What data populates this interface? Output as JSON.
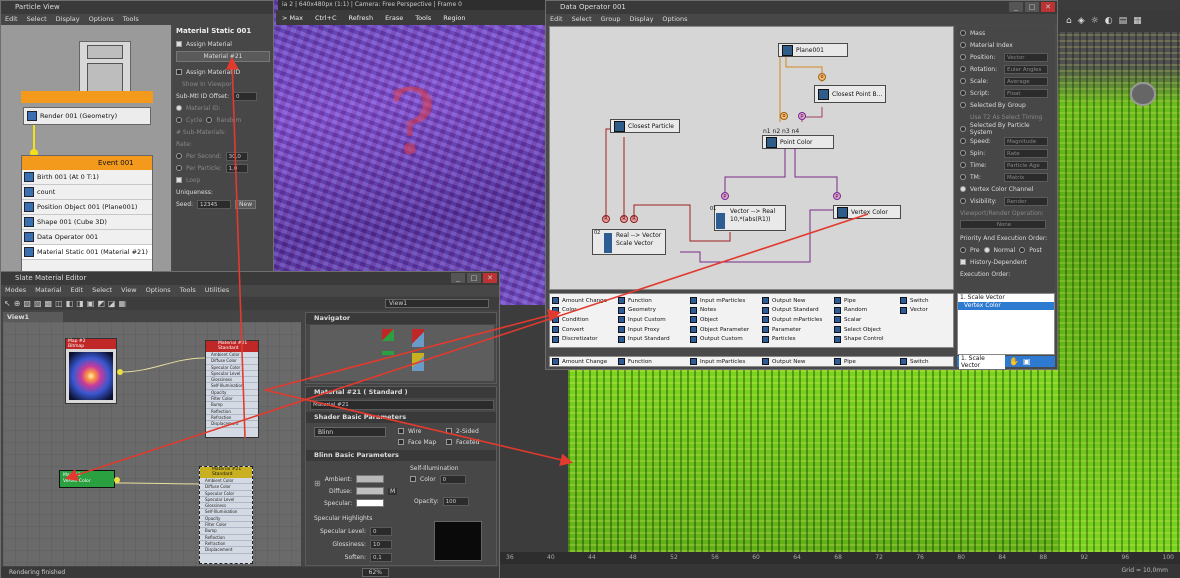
{
  "particle_view": {
    "title": "Particle View",
    "menu": [
      "Edit",
      "Select",
      "Display",
      "Options",
      "Tools"
    ],
    "render_node": "Render 001 (Geometry)",
    "event_title": "Event 001",
    "event_items": [
      "Birth 001 (At 0 T:1)",
      "count",
      "Position Object 001 (Plane001)",
      "Shape 001 (Cube 3D)",
      "Data Operator 001",
      "Material Static 001 (Material #21)"
    ],
    "props_title": "Material Static 001",
    "assign_material": "Assign Material",
    "material_button": "Material #21",
    "assign_material_id": "Assign Material ID",
    "show_in_viewport": "Show In Viewport",
    "sub_mtl_offset": "Sub-Mtl ID Offset:",
    "sub_mtl_value": "0",
    "material_id": "Material ID:",
    "cycle": "Cycle",
    "random": "Random",
    "sub_materials": "# Sub-Materials:",
    "rate": "Rate:",
    "per_second": "Per Second:",
    "per_second_value": "30,0",
    "per_particle": "Per Particle:",
    "per_particle_value": "1,0",
    "loop": "Loop",
    "uniqueness": "Uniqueness:",
    "seed": "Seed:",
    "seed_value": "12345",
    "new": "New"
  },
  "viewport_top": {
    "title": "ia 2 | 640x480px (1:1) | Camera: Free Perspective | Frame 0",
    "toolbar": [
      "> Max",
      "Ctrl+C",
      "Refresh",
      "Erase",
      "Tools",
      "Region"
    ],
    "question": "?"
  },
  "data_operator": {
    "title": "Data Operator 001",
    "menu": [
      "Edit",
      "Select",
      "Group",
      "Display",
      "Options"
    ],
    "nodes": {
      "plane": "Plane001",
      "closest_point": "Closest Point B...",
      "closest_particle": "Closest Particle",
      "point_color": "Point Color",
      "vector_to_real": "Vector --> Real",
      "vector_to_real_expr": "10,*(abs(R1))",
      "real_to_vector": "Real --> Vector",
      "scale_vector": "Scale Vector",
      "vertex_color": "Vertex Color"
    },
    "node_ids": {
      "point_color": "n1 n2 n3 n4",
      "v2r": "01",
      "r2v": "02"
    },
    "operators_col1": [
      "Amount Change",
      "Color",
      "Condition",
      "Convert",
      "Discretizator"
    ],
    "operators_col2": [
      "Function",
      "Geometry",
      "Input Custom",
      "Input Proxy",
      "Input Standard"
    ],
    "operators_col3": [
      "Input mParticles",
      "Notes",
      "Object",
      "Object Parameter",
      "Output Custom"
    ],
    "operators_col4": [
      "Output New",
      "Output Standard",
      "Output mParticles",
      "Parameter",
      "Particles"
    ],
    "operators_col5": [
      "Pipe",
      "Random",
      "Scalar",
      "Select Object",
      "Shape Control"
    ],
    "operators_col6": [
      "Switch",
      "Vector"
    ],
    "bottom_bar": [
      "Amount Change",
      "Function",
      "Input mParticles",
      "Output New",
      "Pipe",
      "Switch"
    ],
    "sub_list": [
      "1. Scale Vector",
      "Vertex Color"
    ],
    "sub_bottom": "1. Scale Vector",
    "props": {
      "mass": "Mass",
      "material_index": "Material Index",
      "position": "Position:",
      "position_value": "Vector",
      "rotation": "Rotation:",
      "rotation_value": "Euler Angles",
      "scale": "Scale:",
      "scale_value": "Average",
      "script": "Script:",
      "script_value": "Float",
      "selected_by_group": "Selected By Group",
      "use_t2": "Use T2 As Select Timing",
      "selected_by_ps": "Selected By Particle System",
      "speed": "Speed:",
      "speed_value": "Magnitude",
      "spin": "Spin:",
      "spin_value": "Rate",
      "time": "Time:",
      "time_value": "Particle Age",
      "tm": "TM:",
      "tm_value": "Matrix",
      "vertex_color_channel": "Vertex Color Channel",
      "visibility": "Visibility:",
      "visibility_value": "Render",
      "viewport_render_op": "Viewport/Render Operation:",
      "none": "None",
      "priority": "Priority And Execution Order:",
      "pre": "Pre",
      "normal": "Normal",
      "post": "Post",
      "history": "History-Dependent",
      "execution_order": "Execution Order:"
    }
  },
  "slate": {
    "title": "Slate Material Editor",
    "menu": [
      "Modes",
      "Material",
      "Edit",
      "Select",
      "View",
      "Options",
      "Tools",
      "Utilities"
    ],
    "view_dropdown": "View1",
    "tab": "View1",
    "navigator": "Navigator",
    "map_node_title": "Map #2",
    "map_node_sub": "Bitmap",
    "mat_node_title": "Material #21",
    "mat_node_sub": "Standard",
    "mat_slots": [
      "Ambient Color",
      "Diffuse Color",
      "Specular Color",
      "Specular Level",
      "Glossiness",
      "Self-Illumination",
      "Opacity",
      "Filter Color",
      "Bump",
      "Reflection",
      "Refraction",
      "Displacement"
    ],
    "mat2_title": "Material #21",
    "mat2_sub": "Standard",
    "vc_node_title": "Map #3",
    "vc_node_sub": "Vertex Color",
    "params_header": "Material #21  ( Standard )",
    "params_name": "Material #21",
    "shader_basic": "Shader Basic Parameters",
    "shader": "Blinn",
    "wire": "Wire",
    "two_sided": "2-Sided",
    "face_map": "Face Map",
    "faceted": "Faceted",
    "blinn_basic": "Blinn Basic Parameters",
    "self_illum": "Self-Illumination",
    "color": "Color",
    "color_value": "0",
    "ambient": "Ambient:",
    "diffuse": "Diffuse:",
    "specular": "Specular:",
    "m": "M",
    "opacity": "Opacity:",
    "opacity_value": "100",
    "spec_highlights": "Specular Highlights",
    "spec_level": "Specular Level:",
    "spec_level_value": "0",
    "glossiness": "Glossiness:",
    "glossiness_value": "10",
    "soften": "Soften:",
    "soften_value": "0,1",
    "zoom": "62%",
    "status": "Rendering finished"
  },
  "ruler": [
    "36",
    "40",
    "44",
    "48",
    "52",
    "56",
    "60",
    "64",
    "68",
    "72",
    "76",
    "80",
    "84",
    "88",
    "92",
    "96",
    "100"
  ],
  "status_right": "Grid = 10,0mm",
  "colors": {
    "arrow": "#e23a2e",
    "orange": "#f39a1c",
    "green": "#7ccf2a",
    "purple": "#7e3ad8"
  }
}
